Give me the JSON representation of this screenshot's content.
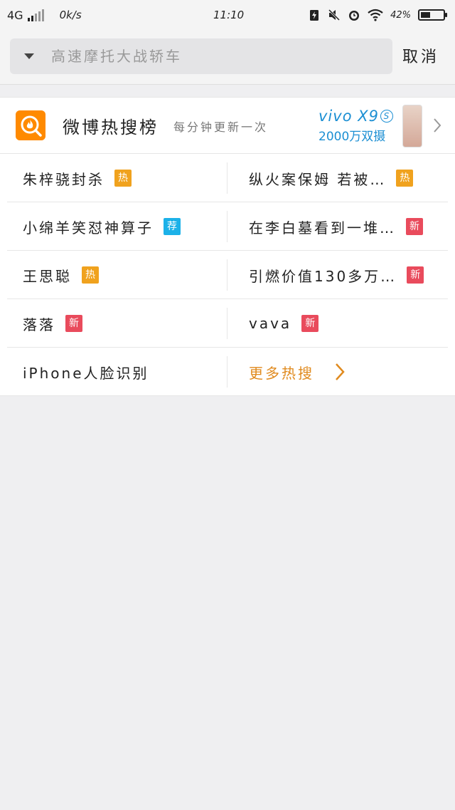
{
  "status_bar": {
    "network": "4G",
    "speed": "0k/s",
    "time": "11:10",
    "battery": "42%",
    "battery_level": 0.42
  },
  "search": {
    "placeholder": "高速摩托大战轿车",
    "cancel_label": "取消"
  },
  "hot_search": {
    "title": "微博热搜榜",
    "subtitle": "每分钟更新一次",
    "ad": {
      "brand": "vivo",
      "model": "X9",
      "badge": "S",
      "tagline": "2000万双摄"
    },
    "items": [
      {
        "text": "朱梓骁封杀",
        "tag": "热",
        "tag_color": "#f0a21e"
      },
      {
        "text": "纵火案保姆 若被…",
        "tag": "热",
        "tag_color": "#f0a21e"
      },
      {
        "text": "小绵羊笑怼神算子",
        "tag": "荐",
        "tag_color": "#1cb1e8"
      },
      {
        "text": "在李白墓看到一堆…",
        "tag": "新",
        "tag_color": "#e94b5c"
      },
      {
        "text": "王思聪",
        "tag": "热",
        "tag_color": "#f0a21e"
      },
      {
        "text": "引燃价值130多万…",
        "tag": "新",
        "tag_color": "#e94b5c"
      },
      {
        "text": "落落",
        "tag": "新",
        "tag_color": "#e94b5c"
      },
      {
        "text": "vava",
        "tag": "新",
        "tag_color": "#e94b5c"
      },
      {
        "text": "iPhone人脸识别",
        "tag": "",
        "tag_color": ""
      }
    ],
    "more_label": "更多热搜"
  },
  "colors": {
    "accent_orange": "#ff8a00",
    "more_orange": "#e08a1e",
    "ad_blue": "#1c8fd3"
  }
}
